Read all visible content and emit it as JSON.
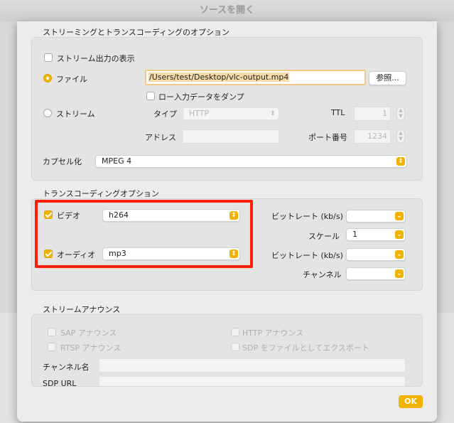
{
  "window": {
    "title": "ソースを開く"
  },
  "streaming_options": {
    "section_title": "ストリーミングとトランスコーディングのオプション",
    "show_stream_output": {
      "label": "ストリーム出力の表示",
      "checked": false
    },
    "file": {
      "label": "ファイル",
      "selected": true,
      "path": "/Users/test/Desktop/vlc-output.mp4",
      "browse_label": "参照...",
      "dump_raw": {
        "label": "ロー入力データをダンプ",
        "checked": false
      }
    },
    "stream": {
      "label": "ストリーム",
      "selected": false,
      "type_label": "タイプ",
      "type_value": "HTTP",
      "ttl_label": "TTL",
      "ttl_value": "1",
      "address_label": "アドレス",
      "address_value": "",
      "port_label": "ポート番号",
      "port_value": "1234"
    },
    "encapsulation": {
      "label": "カプセル化",
      "value": "MPEG 4"
    }
  },
  "transcoding": {
    "section_title": "トランスコーディングオプション",
    "video": {
      "label": "ビデオ",
      "checked": true,
      "codec": "h264"
    },
    "audio": {
      "label": "オーディオ",
      "checked": true,
      "codec": "mp3"
    },
    "video_bitrate_label": "ビットレート (kb/s)",
    "video_bitrate_value": "",
    "scale_label": "スケール",
    "scale_value": "1",
    "audio_bitrate_label": "ビットレート (kb/s)",
    "audio_bitrate_value": "",
    "channels_label": "チャンネル",
    "channels_value": ""
  },
  "stream_announce": {
    "section_title": "ストリームアナウンス",
    "sap": "SAP アナウンス",
    "rtsp": "RTSP アナウンス",
    "http": "HTTP アナウンス",
    "sdp": "SDP をファイルとしてエクスポート",
    "channel_name_label": "チャンネル名",
    "sdp_url_label": "SDP URL"
  },
  "ok_label": "OK",
  "colors": {
    "accent": "#f0b400",
    "highlight": "#ff1e00"
  }
}
